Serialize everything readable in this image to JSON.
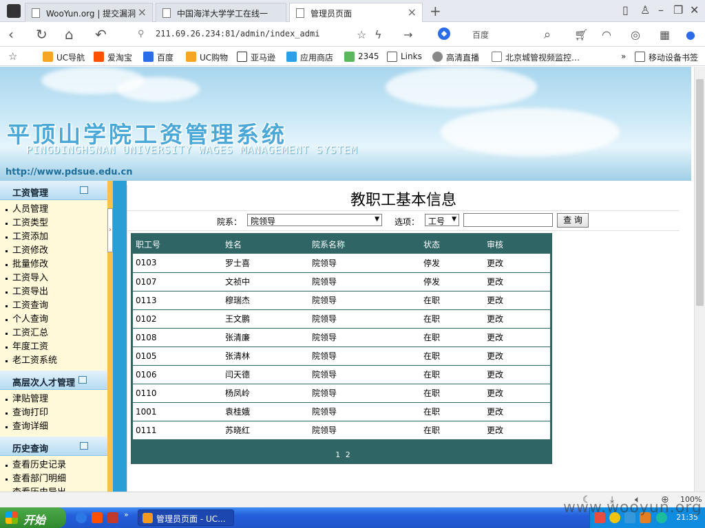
{
  "browser": {
    "tabs": [
      {
        "label": "WooYun.org | 提交漏洞",
        "active": false
      },
      {
        "label": "中国海洋大学学工在线一",
        "active": false
      },
      {
        "label": "管理员页面",
        "active": true
      }
    ],
    "url": "211.69.26.234:81/admin/index_admi",
    "search_engine": "百度",
    "bookmarks": [
      "UC导航",
      "爱淘宝",
      "百度",
      "UC购物",
      "亚马逊",
      "应用商店",
      "2345",
      "Links",
      "高清直播",
      "北京城管视频监控…",
      "移动设备书签"
    ],
    "zoom": "100%"
  },
  "banner": {
    "title_cn": "平顶山学院工资管理系统",
    "title_en": "PINGDINGHSNAN UNIVERSITY WAGES  MANAGEMENT SYSTEM",
    "site_url": "http://www.pdsue.edu.cn"
  },
  "sidebar": {
    "sections": [
      {
        "title": "工资管理",
        "items": [
          "人员管理",
          "工资类型",
          "工资添加",
          "工资修改",
          "批量修改",
          "工资导入",
          "工资导出",
          "工资查询",
          "个人查询",
          "工资汇总",
          "年度工资",
          "老工资系统"
        ]
      },
      {
        "title": "高层次人才管理",
        "items": [
          "津贴管理",
          "查询打印",
          "查询详细"
        ]
      },
      {
        "title": "历史查询",
        "items": [
          "查看历史记录",
          "查看部门明细",
          "查看历史导出"
        ]
      }
    ]
  },
  "main": {
    "title": "教职工基本信息",
    "filter": {
      "dept_label": "院系：",
      "dept_value": "院领导",
      "option_label": "选项：",
      "option_value": "工号",
      "query_value": "",
      "query_button": "查 询"
    },
    "table": {
      "headers": [
        "职工号",
        "姓名",
        "院系名称",
        "状态",
        "审核"
      ],
      "rows": [
        [
          "0103",
          "罗士喜",
          "院领导",
          "停发",
          "更改"
        ],
        [
          "0107",
          "文祯中",
          "院领导",
          "停发",
          "更改"
        ],
        [
          "0113",
          "穆瑞杰",
          "院领导",
          "在职",
          "更改"
        ],
        [
          "0102",
          "王文鹏",
          "院领导",
          "在职",
          "更改"
        ],
        [
          "0108",
          "张清廉",
          "院领导",
          "在职",
          "更改"
        ],
        [
          "0105",
          "张清林",
          "院领导",
          "在职",
          "更改"
        ],
        [
          "0106",
          "闫天德",
          "院领导",
          "在职",
          "更改"
        ],
        [
          "0110",
          "杨凤岭",
          "院领导",
          "在职",
          "更改"
        ],
        [
          "1001",
          "袁桂娥",
          "院领导",
          "在职",
          "更改"
        ],
        [
          "0111",
          "苏晓红",
          "院领导",
          "在职",
          "更改"
        ]
      ],
      "pages": [
        "1",
        "2"
      ]
    }
  },
  "taskbar": {
    "start_label": "开始",
    "task_item": "管理员页面 - UC...",
    "clock": "21:35"
  },
  "watermark": "www.wooyun.org"
}
